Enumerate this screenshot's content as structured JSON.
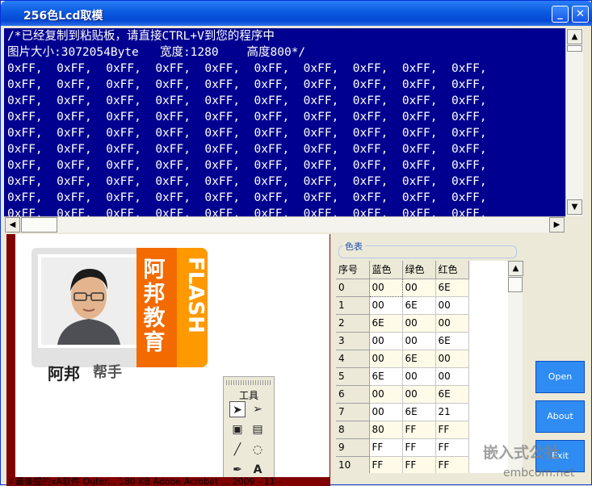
{
  "window": {
    "title": "256色Lcd取模",
    "minimize": "_",
    "close": "✕"
  },
  "code": {
    "comment1": "/*已经复制到粘贴板，请直接CTRL+V到您的程序中",
    "comment2": "图片大小:3072054Byte   宽度:1280    高度800*/",
    "row": "0xFF,  0xFF,  0xFF,  0xFF,  0xFF,  0xFF,  0xFF,  0xFF,  0xFF,  0xFF,",
    "rows_visible": 10
  },
  "image": {
    "brand_left": "阿邦",
    "brand_helper": "帮手",
    "brand_vertical": "阿邦教育",
    "brand_flash": "FLASH"
  },
  "toolbox": {
    "title": "工具"
  },
  "palette": {
    "group_label": "色表",
    "headers": [
      "序号",
      "蓝色",
      "绿色",
      "红色"
    ],
    "rows": [
      [
        "0",
        "00",
        "00",
        "6E"
      ],
      [
        "1",
        "00",
        "6E",
        "00"
      ],
      [
        "2",
        "6E",
        "00",
        "00"
      ],
      [
        "3",
        "00",
        "00",
        "6E"
      ],
      [
        "4",
        "00",
        "6E",
        "00"
      ],
      [
        "5",
        "6E",
        "00",
        "00"
      ],
      [
        "6",
        "00",
        "00",
        "6E"
      ],
      [
        "7",
        "00",
        "6E",
        "21"
      ],
      [
        "8",
        "80",
        "FF",
        "FF"
      ],
      [
        "9",
        "FF",
        "FF",
        "FF"
      ],
      [
        "10",
        "FF",
        "FF",
        "FF"
      ]
    ]
  },
  "buttons": {
    "open": "Open",
    "about": "About",
    "exit": "Exit"
  },
  "watermark": {
    "text": "嵌入式公社",
    "url": "embcom.net"
  },
  "bottom_text": "ゞ最後提的xA软件    Outer...      180 KB  Adobe Acrobat ...   2009 - 11 -"
}
